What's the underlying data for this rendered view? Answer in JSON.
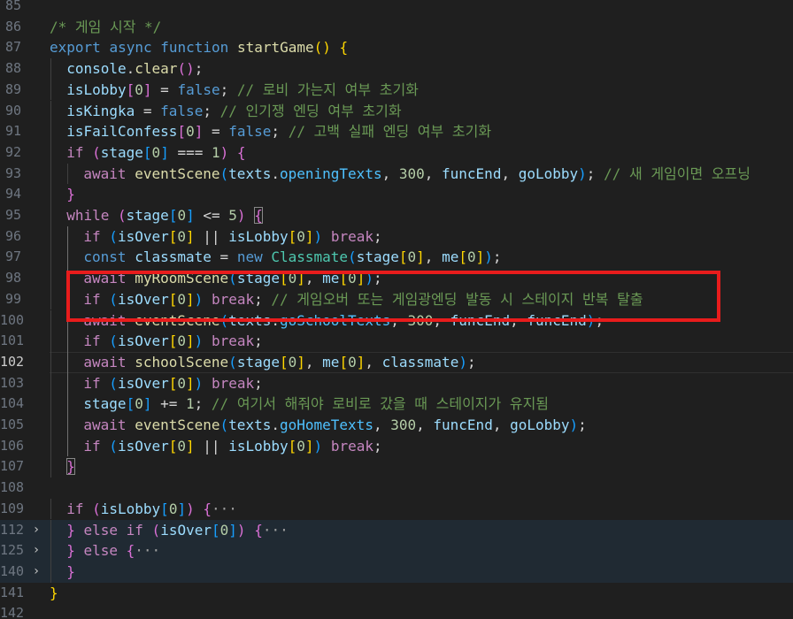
{
  "colors": {
    "background": "#1f1f1f",
    "comment": "#6a9955",
    "keyword": "#569cd6",
    "control": "#c586c0",
    "function": "#dcdcaa",
    "variable": "#9cdcfe",
    "number": "#b5cea8",
    "class": "#4ec9b0",
    "highlight_box": "#e81c1c"
  },
  "lines": [
    {
      "ln": "85",
      "tokens": []
    },
    {
      "ln": "86",
      "tokens": [
        [
          "/* 게임 시작 */",
          "comment"
        ]
      ]
    },
    {
      "ln": "87",
      "tokens": [
        [
          "export",
          "kw"
        ],
        [
          " ",
          "plain"
        ],
        [
          "async",
          "kw"
        ],
        [
          " ",
          "plain"
        ],
        [
          "function",
          "kw"
        ],
        [
          " ",
          "plain"
        ],
        [
          "startGame",
          "fn"
        ],
        [
          "() {",
          "b1"
        ]
      ]
    },
    {
      "ln": "88",
      "tokens": [
        [
          "console",
          "var"
        ],
        [
          ".",
          "plain"
        ],
        [
          "clear",
          "fn"
        ],
        [
          "()",
          "b2"
        ],
        [
          ";",
          "plain"
        ]
      ]
    },
    {
      "ln": "89",
      "tokens": [
        [
          "isLobby",
          "var"
        ],
        [
          "[",
          "b2"
        ],
        [
          "0",
          "num"
        ],
        [
          "]",
          "b2"
        ],
        [
          " = ",
          "plain"
        ],
        [
          "false",
          "kw"
        ],
        [
          "; ",
          "plain"
        ],
        [
          "// 로비 가는지 여부 초기화",
          "comment"
        ]
      ]
    },
    {
      "ln": "90",
      "tokens": [
        [
          "isKingka",
          "var"
        ],
        [
          " = ",
          "plain"
        ],
        [
          "false",
          "kw"
        ],
        [
          "; ",
          "plain"
        ],
        [
          "// 인기쟁 엔딩 여부 초기화",
          "comment"
        ]
      ]
    },
    {
      "ln": "91",
      "tokens": [
        [
          "isFailConfess",
          "var"
        ],
        [
          "[",
          "b2"
        ],
        [
          "0",
          "num"
        ],
        [
          "]",
          "b2"
        ],
        [
          " = ",
          "plain"
        ],
        [
          "false",
          "kw"
        ],
        [
          "; ",
          "plain"
        ],
        [
          "// 고백 실패 엔딩 여부 초기화",
          "comment"
        ]
      ]
    },
    {
      "ln": "92",
      "tokens": [
        [
          "if",
          "ctrl"
        ],
        [
          " ",
          "plain"
        ],
        [
          "(",
          "b2"
        ],
        [
          "stage",
          "var"
        ],
        [
          "[",
          "b3"
        ],
        [
          "0",
          "num"
        ],
        [
          "]",
          "b3"
        ],
        [
          " === ",
          "plain"
        ],
        [
          "1",
          "num"
        ],
        [
          ")",
          "b2"
        ],
        [
          " ",
          "plain"
        ],
        [
          "{",
          "b2"
        ]
      ]
    },
    {
      "ln": "93",
      "tokens": [
        [
          "await",
          "ctrl"
        ],
        [
          " ",
          "plain"
        ],
        [
          "eventScene",
          "fn"
        ],
        [
          "(",
          "b3"
        ],
        [
          "texts",
          "var"
        ],
        [
          ".",
          "plain"
        ],
        [
          "openingTexts",
          "prop"
        ],
        [
          ", ",
          "plain"
        ],
        [
          "300",
          "num"
        ],
        [
          ", ",
          "plain"
        ],
        [
          "funcEnd",
          "var"
        ],
        [
          ", ",
          "plain"
        ],
        [
          "goLobby",
          "var"
        ],
        [
          ")",
          "b3"
        ],
        [
          "; ",
          "plain"
        ],
        [
          "// 새 게임이면 오프닝",
          "comment"
        ]
      ]
    },
    {
      "ln": "94",
      "tokens": [
        [
          "}",
          "b2"
        ]
      ]
    },
    {
      "ln": "95",
      "tokens": [
        [
          "while",
          "ctrl"
        ],
        [
          " ",
          "plain"
        ],
        [
          "(",
          "b2"
        ],
        [
          "stage",
          "var"
        ],
        [
          "[",
          "b3"
        ],
        [
          "0",
          "num"
        ],
        [
          "]",
          "b3"
        ],
        [
          " <= ",
          "plain"
        ],
        [
          "5",
          "num"
        ],
        [
          ")",
          "b2"
        ],
        [
          " ",
          "plain"
        ],
        [
          "{",
          "b2box"
        ]
      ]
    },
    {
      "ln": "96",
      "tokens": [
        [
          "if",
          "ctrl"
        ],
        [
          " ",
          "plain"
        ],
        [
          "(",
          "b3"
        ],
        [
          "isOver",
          "var"
        ],
        [
          "[",
          "b1"
        ],
        [
          "0",
          "num"
        ],
        [
          "]",
          "b1"
        ],
        [
          " || ",
          "plain"
        ],
        [
          "isLobby",
          "var"
        ],
        [
          "[",
          "b1"
        ],
        [
          "0",
          "num"
        ],
        [
          "]",
          "b1"
        ],
        [
          ")",
          "b3"
        ],
        [
          " ",
          "plain"
        ],
        [
          "break",
          "ctrl"
        ],
        [
          ";",
          "plain"
        ]
      ]
    },
    {
      "ln": "97",
      "tokens": [
        [
          "const",
          "kw"
        ],
        [
          " ",
          "plain"
        ],
        [
          "classmate",
          "var"
        ],
        [
          " = ",
          "plain"
        ],
        [
          "new",
          "kw"
        ],
        [
          " ",
          "plain"
        ],
        [
          "Classmate",
          "cls"
        ],
        [
          "(",
          "b3"
        ],
        [
          "stage",
          "var"
        ],
        [
          "[",
          "b1"
        ],
        [
          "0",
          "num"
        ],
        [
          "]",
          "b1"
        ],
        [
          ", ",
          "plain"
        ],
        [
          "me",
          "var"
        ],
        [
          "[",
          "b1"
        ],
        [
          "0",
          "num"
        ],
        [
          "]",
          "b1"
        ],
        [
          ")",
          "b3"
        ],
        [
          ";",
          "plain"
        ]
      ]
    },
    {
      "ln": "98",
      "tokens": [
        [
          "await",
          "ctrl"
        ],
        [
          " ",
          "plain"
        ],
        [
          "myRoomScene",
          "fn"
        ],
        [
          "(",
          "b3"
        ],
        [
          "stage",
          "var"
        ],
        [
          "[",
          "b1"
        ],
        [
          "0",
          "num"
        ],
        [
          "]",
          "b1"
        ],
        [
          ", ",
          "plain"
        ],
        [
          "me",
          "var"
        ],
        [
          "[",
          "b1"
        ],
        [
          "0",
          "num"
        ],
        [
          "]",
          "b1"
        ],
        [
          ")",
          "b3"
        ],
        [
          ";",
          "plain"
        ]
      ]
    },
    {
      "ln": "99",
      "tokens": [
        [
          "if",
          "ctrl"
        ],
        [
          " ",
          "plain"
        ],
        [
          "(",
          "b3"
        ],
        [
          "isOver",
          "var"
        ],
        [
          "[",
          "b1"
        ],
        [
          "0",
          "num"
        ],
        [
          "]",
          "b1"
        ],
        [
          ")",
          "b3"
        ],
        [
          " ",
          "plain"
        ],
        [
          "break",
          "ctrl"
        ],
        [
          "; ",
          "plain"
        ],
        [
          "// 게임오버 또는 게임광엔딩 발동 시 스테이지 반복 탈출",
          "comment"
        ]
      ]
    },
    {
      "ln": "100",
      "tokens": [
        [
          "await",
          "ctrl"
        ],
        [
          " ",
          "plain"
        ],
        [
          "eventScene",
          "fn"
        ],
        [
          "(",
          "b3"
        ],
        [
          "texts",
          "var"
        ],
        [
          ".",
          "plain"
        ],
        [
          "goSchoolTexts",
          "prop"
        ],
        [
          ", ",
          "plain"
        ],
        [
          "300",
          "num"
        ],
        [
          ", ",
          "plain"
        ],
        [
          "funcEnd",
          "var"
        ],
        [
          ", ",
          "plain"
        ],
        [
          "funcEnd",
          "var"
        ],
        [
          ")",
          "b3"
        ],
        [
          ";",
          "plain"
        ]
      ]
    },
    {
      "ln": "101",
      "tokens": [
        [
          "if",
          "ctrl"
        ],
        [
          " ",
          "plain"
        ],
        [
          "(",
          "b3"
        ],
        [
          "isOver",
          "var"
        ],
        [
          "[",
          "b1"
        ],
        [
          "0",
          "num"
        ],
        [
          "]",
          "b1"
        ],
        [
          ")",
          "b3"
        ],
        [
          " ",
          "plain"
        ],
        [
          "break",
          "ctrl"
        ],
        [
          ";",
          "plain"
        ]
      ]
    },
    {
      "ln": "102",
      "tokens": [
        [
          "await",
          "ctrl"
        ],
        [
          " ",
          "plain"
        ],
        [
          "schoolScene",
          "fn"
        ],
        [
          "(",
          "b3"
        ],
        [
          "stage",
          "var"
        ],
        [
          "[",
          "b1"
        ],
        [
          "0",
          "num"
        ],
        [
          "]",
          "b1"
        ],
        [
          ", ",
          "plain"
        ],
        [
          "me",
          "var"
        ],
        [
          "[",
          "b1"
        ],
        [
          "0",
          "num"
        ],
        [
          "]",
          "b1"
        ],
        [
          ", ",
          "plain"
        ],
        [
          "classmate",
          "var"
        ],
        [
          ")",
          "b3"
        ],
        [
          ";",
          "plain"
        ]
      ]
    },
    {
      "ln": "103",
      "tokens": [
        [
          "if",
          "ctrl"
        ],
        [
          " ",
          "plain"
        ],
        [
          "(",
          "b3"
        ],
        [
          "isOver",
          "var"
        ],
        [
          "[",
          "b1"
        ],
        [
          "0",
          "num"
        ],
        [
          "]",
          "b1"
        ],
        [
          ")",
          "b3"
        ],
        [
          " ",
          "plain"
        ],
        [
          "break",
          "ctrl"
        ],
        [
          ";",
          "plain"
        ]
      ]
    },
    {
      "ln": "104",
      "tokens": [
        [
          "stage",
          "var"
        ],
        [
          "[",
          "b3"
        ],
        [
          "0",
          "num"
        ],
        [
          "]",
          "b3"
        ],
        [
          " += ",
          "plain"
        ],
        [
          "1",
          "num"
        ],
        [
          "; ",
          "plain"
        ],
        [
          "// 여기서 해줘야 로비로 갔을 때 스테이지가 유지됨",
          "comment"
        ]
      ]
    },
    {
      "ln": "105",
      "tokens": [
        [
          "await",
          "ctrl"
        ],
        [
          " ",
          "plain"
        ],
        [
          "eventScene",
          "fn"
        ],
        [
          "(",
          "b3"
        ],
        [
          "texts",
          "var"
        ],
        [
          ".",
          "plain"
        ],
        [
          "goHomeTexts",
          "prop"
        ],
        [
          ", ",
          "plain"
        ],
        [
          "300",
          "num"
        ],
        [
          ", ",
          "plain"
        ],
        [
          "funcEnd",
          "var"
        ],
        [
          ", ",
          "plain"
        ],
        [
          "goLobby",
          "var"
        ],
        [
          ")",
          "b3"
        ],
        [
          ";",
          "plain"
        ]
      ]
    },
    {
      "ln": "106",
      "tokens": [
        [
          "if",
          "ctrl"
        ],
        [
          " ",
          "plain"
        ],
        [
          "(",
          "b3"
        ],
        [
          "isOver",
          "var"
        ],
        [
          "[",
          "b1"
        ],
        [
          "0",
          "num"
        ],
        [
          "]",
          "b1"
        ],
        [
          " || ",
          "plain"
        ],
        [
          "isLobby",
          "var"
        ],
        [
          "[",
          "b1"
        ],
        [
          "0",
          "num"
        ],
        [
          "]",
          "b1"
        ],
        [
          ")",
          "b3"
        ],
        [
          " ",
          "plain"
        ],
        [
          "break",
          "ctrl"
        ],
        [
          ";",
          "plain"
        ]
      ]
    },
    {
      "ln": "107",
      "tokens": [
        [
          "}",
          "b2box"
        ]
      ]
    },
    {
      "ln": "108",
      "tokens": []
    },
    {
      "ln": "109",
      "tokens": [
        [
          "if",
          "ctrl"
        ],
        [
          " ",
          "plain"
        ],
        [
          "(",
          "b2"
        ],
        [
          "isLobby",
          "var"
        ],
        [
          "[",
          "b3"
        ],
        [
          "0",
          "num"
        ],
        [
          "]",
          "b3"
        ],
        [
          ")",
          "b2"
        ],
        [
          " ",
          "plain"
        ],
        [
          "{",
          "b2"
        ],
        [
          "···",
          "ell"
        ]
      ]
    },
    {
      "ln": "112",
      "tokens": [
        [
          "}",
          "b2"
        ],
        [
          " ",
          "plain"
        ],
        [
          "else",
          "ctrl"
        ],
        [
          " ",
          "plain"
        ],
        [
          "if",
          "ctrl"
        ],
        [
          " ",
          "plain"
        ],
        [
          "(",
          "b2"
        ],
        [
          "isOver",
          "var"
        ],
        [
          "[",
          "b3"
        ],
        [
          "0",
          "num"
        ],
        [
          "]",
          "b3"
        ],
        [
          ")",
          "b2"
        ],
        [
          " ",
          "plain"
        ],
        [
          "{",
          "b2"
        ],
        [
          "···",
          "ell"
        ]
      ]
    },
    {
      "ln": "125",
      "tokens": [
        [
          "}",
          "b2"
        ],
        [
          " ",
          "plain"
        ],
        [
          "else",
          "ctrl"
        ],
        [
          " ",
          "plain"
        ],
        [
          "{",
          "b2"
        ],
        [
          "···",
          "ell"
        ]
      ]
    },
    {
      "ln": "140",
      "tokens": [
        [
          "}",
          "b2"
        ]
      ]
    },
    {
      "ln": "141",
      "tokens": [
        [
          "}",
          "b1"
        ]
      ]
    },
    {
      "ln": "142",
      "tokens": []
    }
  ],
  "fold_icon": "chevron-right-icon",
  "fold_glyph": "›"
}
